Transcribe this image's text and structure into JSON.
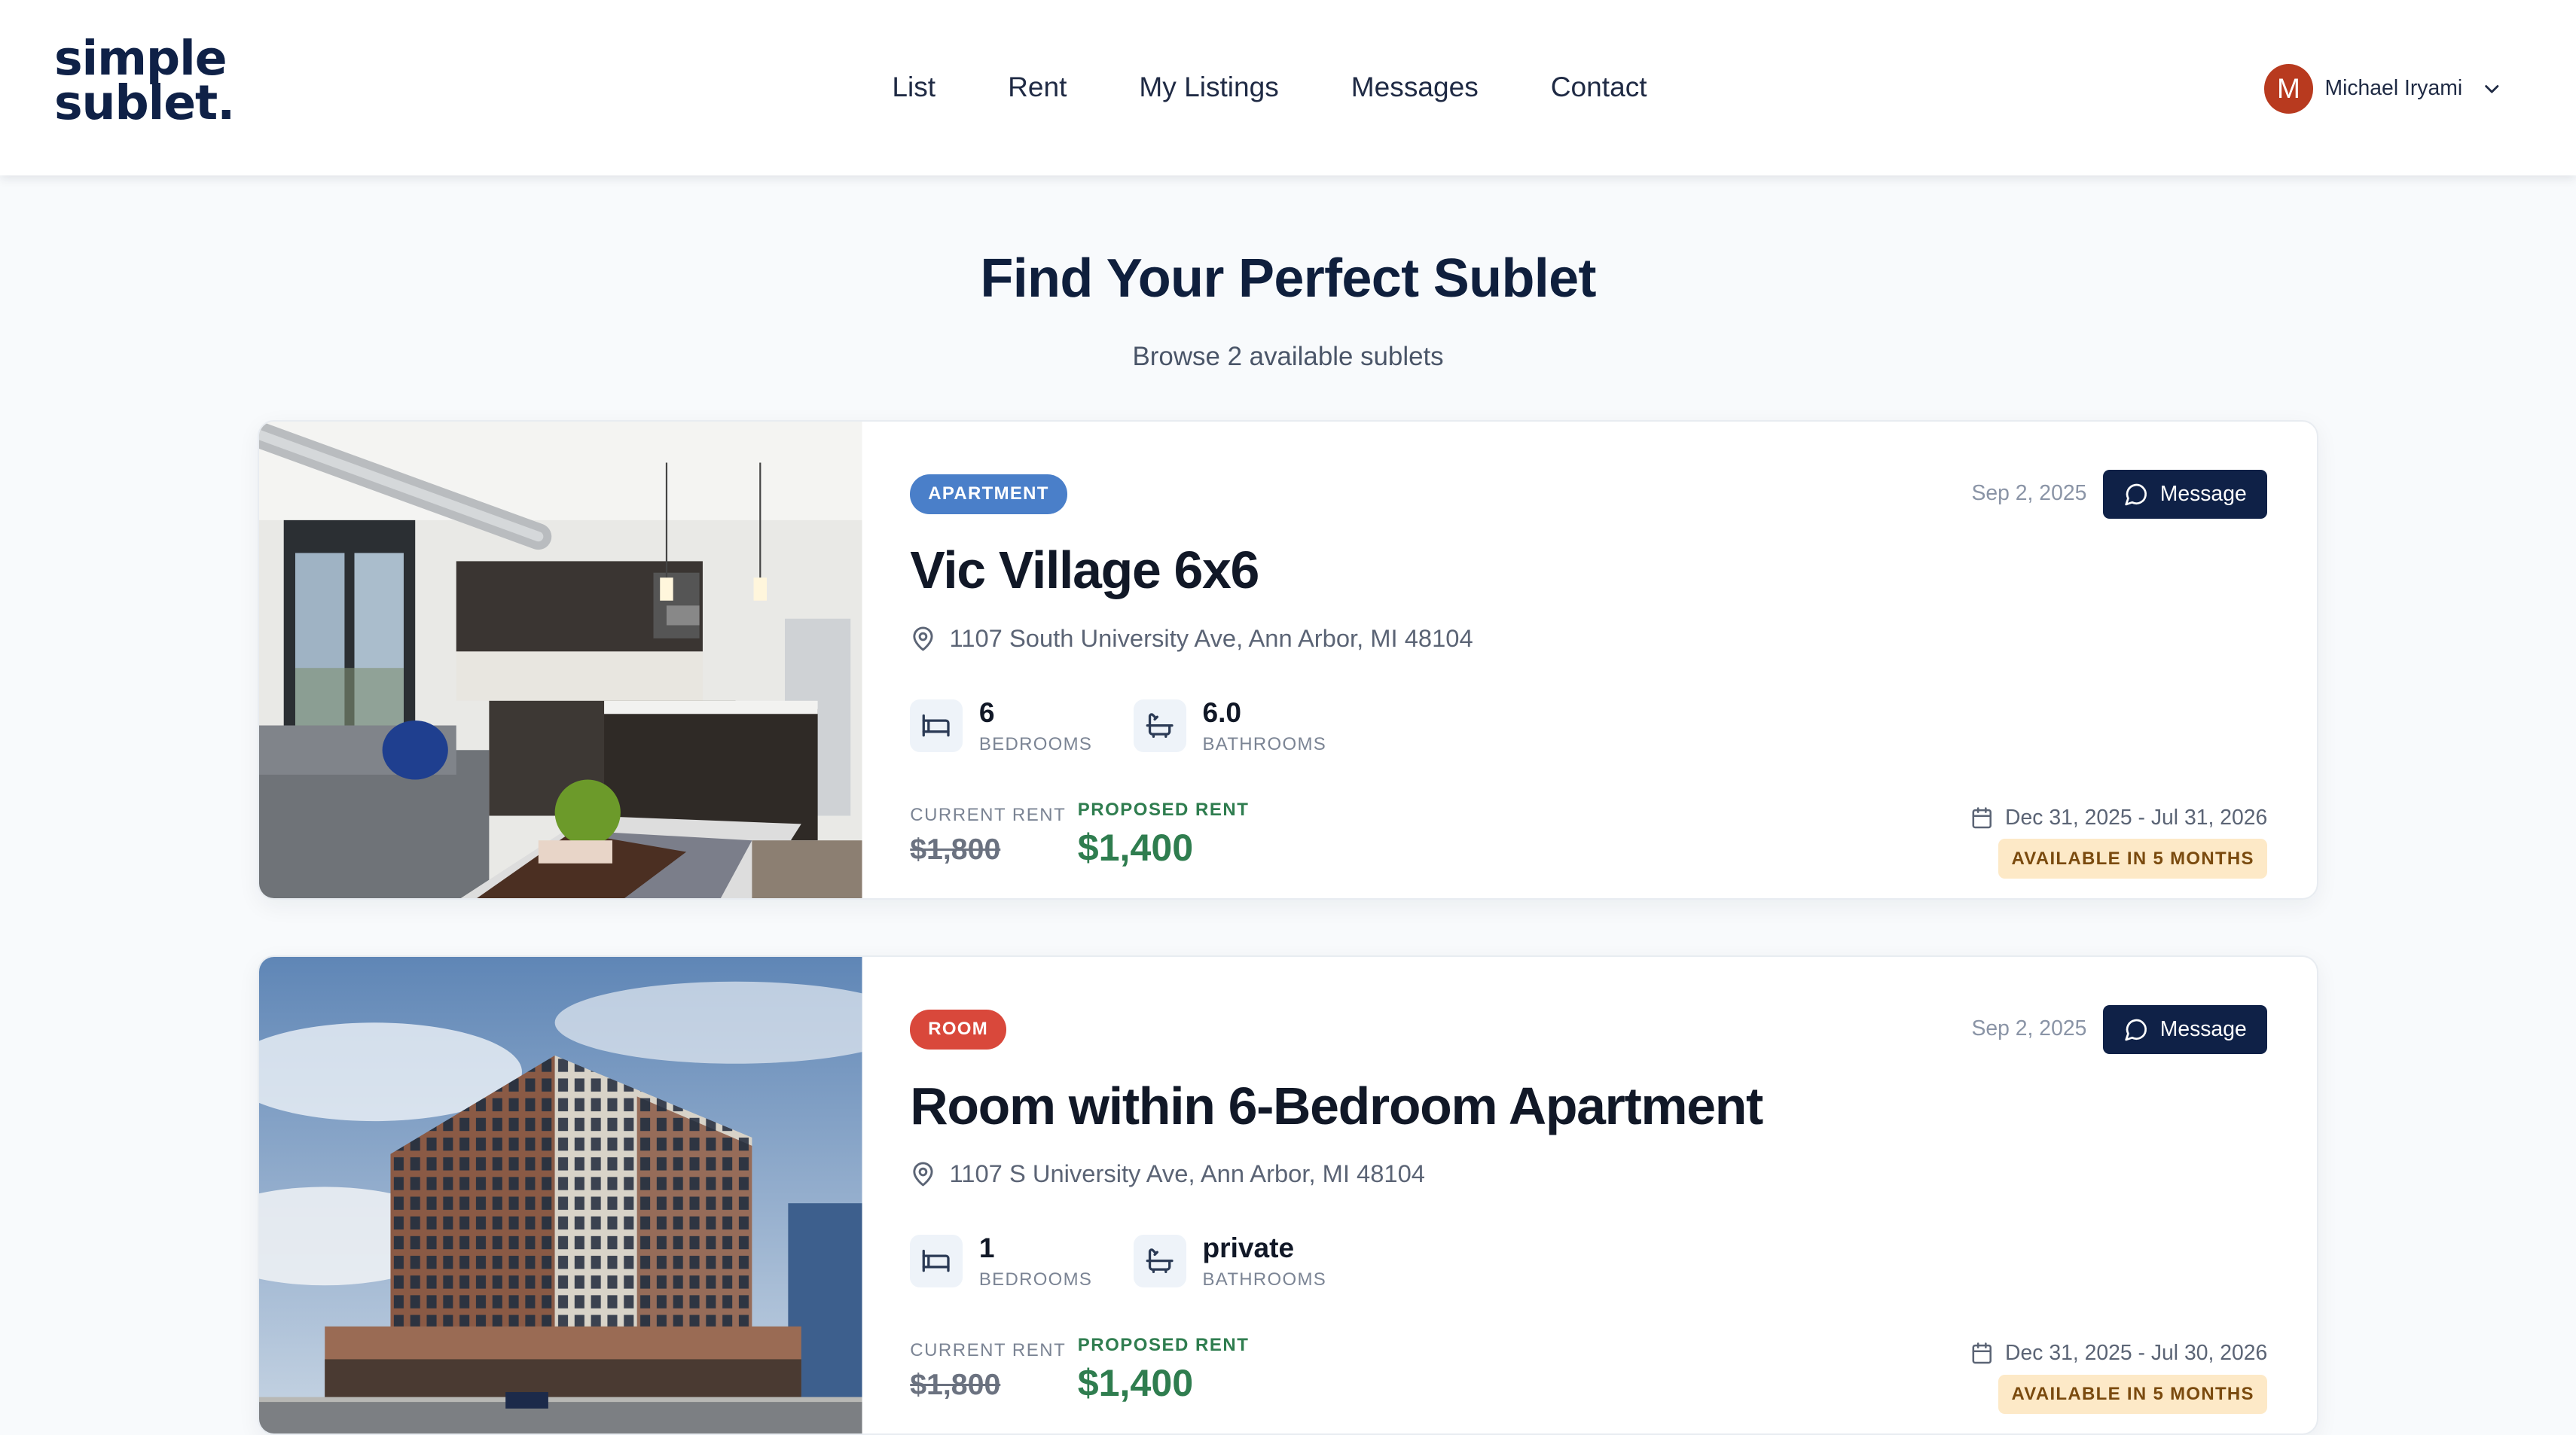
{
  "header": {
    "logo_line1": "simple",
    "logo_line2": "sublet.",
    "nav": [
      "List",
      "Rent",
      "My Listings",
      "Messages",
      "Contact"
    ],
    "user": {
      "initial": "M",
      "name": "Michael Iryami"
    }
  },
  "hero": {
    "title": "Find Your Perfect Sublet",
    "subtitle": "Browse 2 available sublets"
  },
  "labels": {
    "message_button": "Message",
    "bedrooms": "BEDROOMS",
    "bathrooms": "BATHROOMS",
    "current_rent": "CURRENT RENT",
    "proposed_rent": "PROPOSED RENT"
  },
  "listings": [
    {
      "type": "APARTMENT",
      "type_color": "#4a7fc9",
      "posted": "Sep 2, 2025",
      "title": "Vic Village 6x6",
      "address": "1107 South University Ave, Ann Arbor, MI 48104",
      "bedrooms": "6",
      "bathrooms": "6.0",
      "current_rent": "$1,800",
      "proposed_rent": "$1,400",
      "dates": "Dec 31, 2025 - Jul 31, 2026",
      "availability": "AVAILABLE IN 5 MONTHS",
      "image": "kitchen-living-room-photo"
    },
    {
      "type": "ROOM",
      "type_color": "#d9483b",
      "posted": "Sep 2, 2025",
      "title": "Room within 6-Bedroom Apartment",
      "address": "1107 S University Ave, Ann Arbor, MI 48104",
      "bedrooms": "1",
      "bathrooms": "private",
      "current_rent": "$1,800",
      "proposed_rent": "$1,400",
      "dates": "Dec 31, 2025 - Jul 30, 2026",
      "availability": "AVAILABLE IN 5 MONTHS",
      "image": "building-exterior-photo"
    }
  ]
}
